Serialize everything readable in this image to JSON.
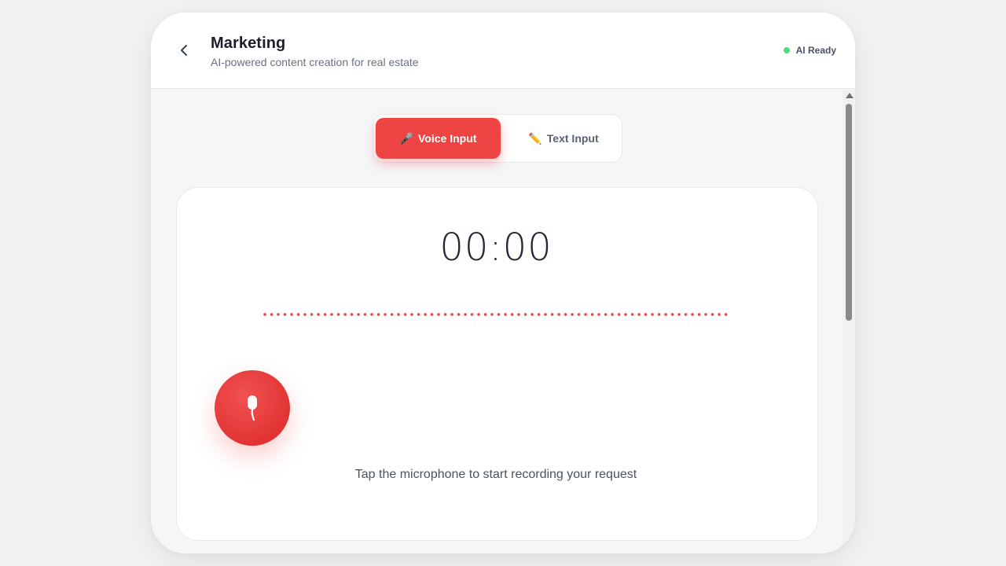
{
  "header": {
    "title": "Marketing",
    "subtitle": "AI-powered content creation for real estate",
    "status_label": "AI Ready",
    "status_color": "#4ade80"
  },
  "mode_toggle": {
    "voice_icon": "🎤",
    "voice_label": "Voice Input",
    "text_icon": "✏️",
    "text_label": "Text Input",
    "active": "voice"
  },
  "recorder": {
    "timer": "00:00",
    "hint": "Tap the microphone to start recording your request",
    "accent_color": "#ef4444"
  }
}
